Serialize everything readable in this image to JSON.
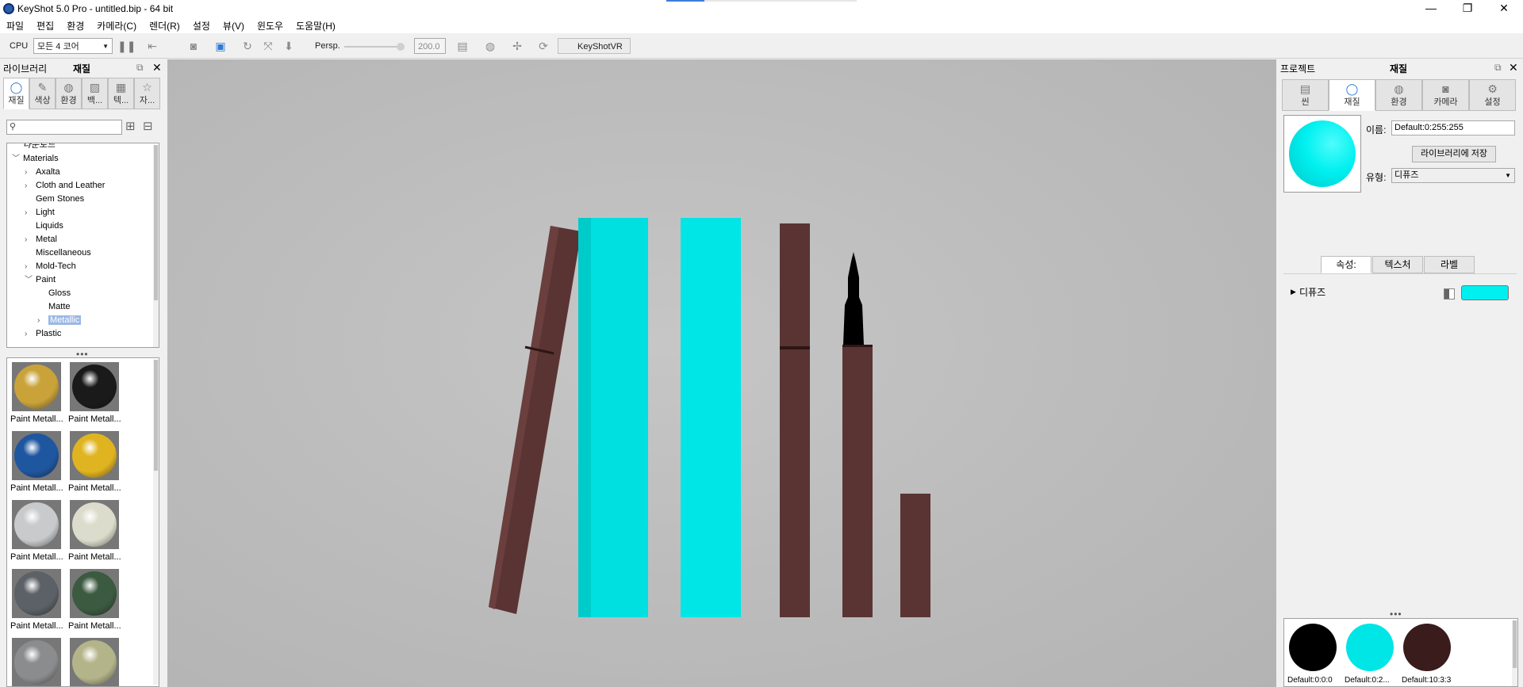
{
  "window": {
    "title": "KeyShot 5.0 Pro  - untitled.bip  - 64 bit",
    "minimize": "—",
    "maximize": "❐",
    "close": "✕"
  },
  "menu": [
    "파일",
    "편집",
    "환경",
    "카메라(C)",
    "렌더(R)",
    "설정",
    "뷰(V)",
    "윈도우",
    "도움말(H)"
  ],
  "toolbar": {
    "cpu_label": "CPU",
    "cores_value": "모든 4 코어",
    "persp_label": "Persp.",
    "focal_value": "200.0",
    "keyshotvr_label": "KeyShotVR"
  },
  "library": {
    "title": "라이브러리",
    "tab_title": "재질",
    "tabs": [
      "재질",
      "색상",
      "환경",
      "백...",
      "텍...",
      "자..."
    ],
    "search_placeholder": "",
    "tree": [
      {
        "label": "다운로드",
        "indent": 0,
        "arrow": ""
      },
      {
        "label": "Materials",
        "indent": 0,
        "arrow": "﹀"
      },
      {
        "label": "Axalta",
        "indent": 1,
        "arrow": "›"
      },
      {
        "label": "Cloth and Leather",
        "indent": 1,
        "arrow": "›"
      },
      {
        "label": "Gem Stones",
        "indent": 1,
        "arrow": ""
      },
      {
        "label": "Light",
        "indent": 1,
        "arrow": "›"
      },
      {
        "label": "Liquids",
        "indent": 1,
        "arrow": ""
      },
      {
        "label": "Metal",
        "indent": 1,
        "arrow": "›"
      },
      {
        "label": "Miscellaneous",
        "indent": 1,
        "arrow": ""
      },
      {
        "label": "Mold-Tech",
        "indent": 1,
        "arrow": "›"
      },
      {
        "label": "Paint",
        "indent": 1,
        "arrow": "﹀"
      },
      {
        "label": "Gloss",
        "indent": 2,
        "arrow": ""
      },
      {
        "label": "Matte",
        "indent": 2,
        "arrow": ""
      },
      {
        "label": "Metallic",
        "indent": 2,
        "arrow": "›",
        "selected": true
      },
      {
        "label": "Plastic",
        "indent": 1,
        "arrow": "›"
      }
    ],
    "thumbs": [
      {
        "label": "Paint Metall...",
        "color": "#c9a23a"
      },
      {
        "label": "Paint Metall...",
        "color": "#1a1a1a"
      },
      {
        "label": "Paint Metall...",
        "color": "#1f56a0"
      },
      {
        "label": "Paint Metall...",
        "color": "#e0b420"
      },
      {
        "label": "Paint Metall...",
        "color": "#c8cacc"
      },
      {
        "label": "Paint Metall...",
        "color": "#dcdccc"
      },
      {
        "label": "Paint Metall...",
        "color": "#5b6166"
      },
      {
        "label": "Paint Metall...",
        "color": "#3b5a40"
      },
      {
        "label": "Paint Metall...",
        "color": "#8a8c8e"
      },
      {
        "label": "Paint Metall...",
        "color": "#b4b48a"
      }
    ]
  },
  "project": {
    "title": "프로젝트",
    "tab_title": "재질",
    "tabs": [
      "씬",
      "재질",
      "환경",
      "카메라",
      "설정"
    ],
    "name_label": "이름:",
    "name_value": "Default:0:255:255",
    "save_button": "라이브러리에 저장",
    "type_label": "유형:",
    "type_value": "디퓨즈",
    "subtabs": [
      "속성:",
      "텍스처",
      "라벨"
    ],
    "diffuse_label": "디퓨즈",
    "diffuse_color": "#00f0f0",
    "materials": [
      {
        "label": "Default:0:0:0",
        "color": "#000000"
      },
      {
        "label": "Default:0:2...",
        "color": "#00e5e5"
      },
      {
        "label": "Default:10:3:3",
        "color": "#3a1c1c"
      }
    ]
  },
  "colors": {
    "cyan": "#00e6e6",
    "brown": "#5a3433",
    "selection": "#9ab8e6"
  }
}
